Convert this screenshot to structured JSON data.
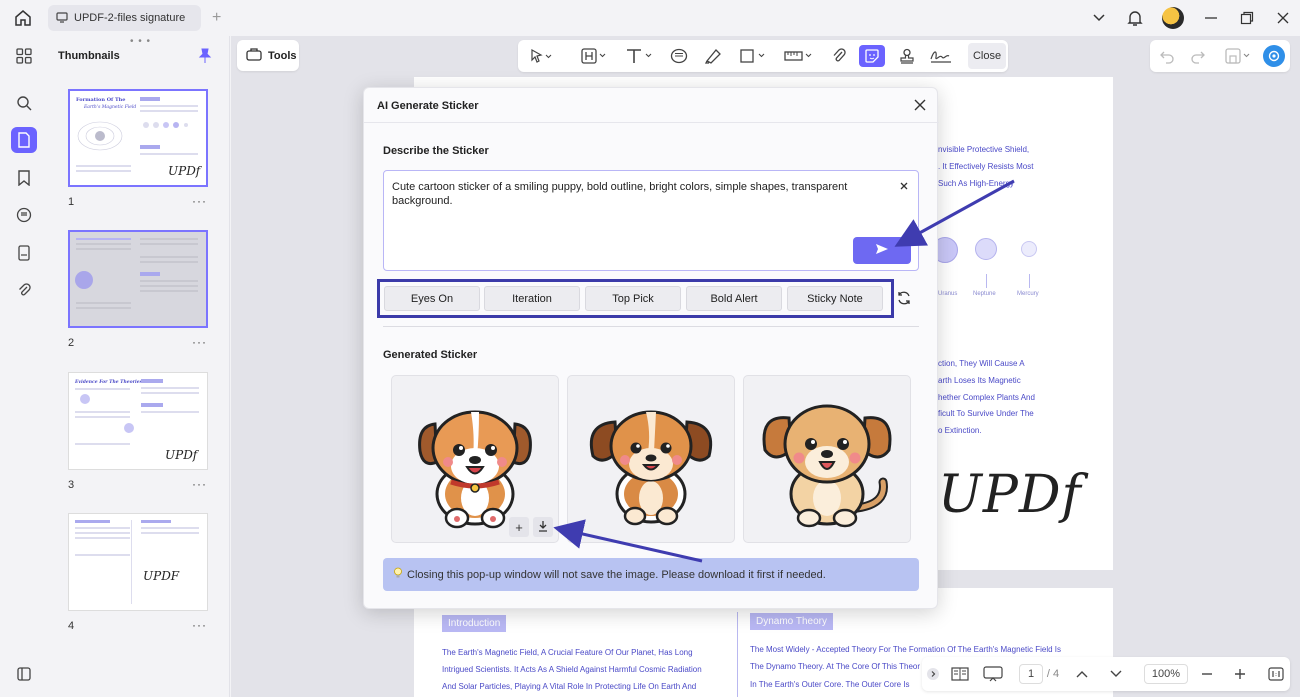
{
  "titlebar": {
    "tab_title": "UPDF-2-files signature"
  },
  "thumbnails": {
    "title": "Thumbnails",
    "pages": [
      {
        "number": "1",
        "heading": "Formation Of The",
        "subheading": "Earth's Magnetic Field",
        "signature": "UPDf"
      },
      {
        "number": "2"
      },
      {
        "number": "3",
        "heading": "Evidence For The Theories",
        "signature": "UPDf"
      },
      {
        "number": "4",
        "signature": "UPDF"
      }
    ]
  },
  "tools_button": {
    "label": "Tools"
  },
  "toolbar": {
    "close_label": "Close"
  },
  "document": {
    "page1_lines": [
      "nvisible Protective Shield,",
      ". It Effectively Resists Most",
      "Such As High-Energy"
    ],
    "planet_labels": [
      "Uranus",
      "Neptune",
      "Mercury"
    ],
    "page1_lines_2": [
      "ction, They Will Cause A",
      "arth Loses Its Magnetic",
      "hether Complex Plants And",
      "ficult To Survive Under The",
      "o Extinction."
    ],
    "signature": "UPDf",
    "page2": {
      "intro_heading": "Introduction",
      "intro_lines": [
        "The Earth's Magnetic Field, A Crucial Feature Of Our Planet, Has Long",
        "Intrigued Scientists. It Acts As A Shield Against Harmful Cosmic Radiation",
        "And Solar Particles, Playing A Vital Role In Protecting Life On Earth And"
      ],
      "dynamo_heading": "Dynamo Theory",
      "dynamo_lines": [
        "The Most Widely - Accepted Theory For The Formation Of The Earth's Magnetic Field Is",
        "The Dynamo Theory. At The Core Of This Theor",
        "In The Earth's Outer Core. The Outer Core Is"
      ]
    }
  },
  "bottom_nav": {
    "page_current": "1",
    "page_total": "/ 4",
    "zoom": "100%"
  },
  "dialog": {
    "title": "AI Generate Sticker",
    "describe_label": "Describe the Sticker",
    "prompt": "Cute cartoon sticker of a smiling puppy, bold outline, bright colors, simple shapes, transparent background.",
    "styles": [
      "Eyes On",
      "Iteration",
      "Top Pick",
      "Bold Alert",
      "Sticky Note"
    ],
    "generated_label": "Generated Sticker",
    "notice": "Closing this pop-up window will not save the image. Please download it first if needed."
  },
  "colors": {
    "accent": "#6b63ff",
    "highlight_box": "#3b3aa9",
    "arrow": "#3f3cb0",
    "doc_text": "#4a49c7"
  }
}
